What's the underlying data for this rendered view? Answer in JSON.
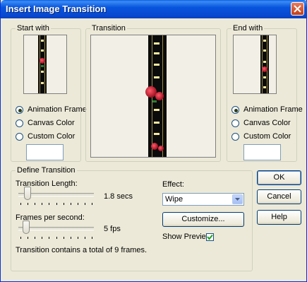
{
  "window": {
    "title": "Insert Image Transition"
  },
  "start_with": {
    "legend": "Start with",
    "options": [
      "Animation Frame",
      "Canvas Color",
      "Custom Color"
    ],
    "selected": "Animation Frame"
  },
  "transition": {
    "legend": "Transition"
  },
  "end_with": {
    "legend": "End with",
    "options": [
      "Animation Frame",
      "Canvas Color",
      "Custom Color"
    ],
    "selected": "Animation Frame"
  },
  "define": {
    "legend": "Define Transition",
    "length_label": "Transition Length:",
    "length_value": "1.8 secs",
    "length_level": 0.12,
    "fps_label": "Frames per second:",
    "fps_value": "5 fps",
    "fps_level": 0.1,
    "summary": "Transition contains a total of 9 frames.",
    "effect_label": "Effect:",
    "effect_value": "Wipe",
    "customize_label": "Customize...",
    "preview_label": "Show Preview",
    "preview_checked": true
  },
  "buttons": {
    "ok": "OK",
    "cancel": "Cancel",
    "help": "Help"
  },
  "icons": {
    "close": "close-icon",
    "dropdown": "chevron-down-icon",
    "check": "checkmark-icon"
  },
  "colors": {
    "titlebar": "#0855dd",
    "face": "#ece9d8",
    "close": "#c63d14"
  }
}
